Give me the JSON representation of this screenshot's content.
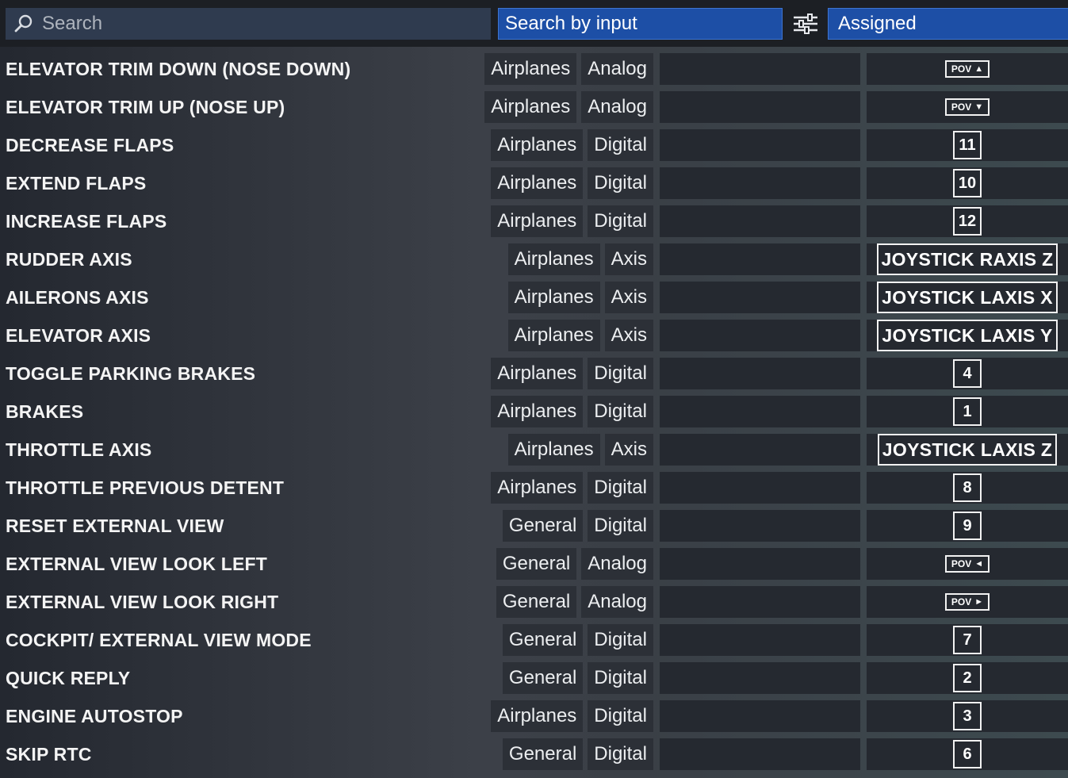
{
  "topbar": {
    "search_placeholder": "Search",
    "search_by_input_label": "Search by input",
    "assigned_label": "Assigned"
  },
  "rows": [
    {
      "action": "ELEVATOR TRIM DOWN (NOSE DOWN)",
      "category": "Airplanes",
      "type": "Analog",
      "binding": "POV",
      "binding_kind": "pov",
      "arrow": "▲"
    },
    {
      "action": "ELEVATOR TRIM UP (NOSE UP)",
      "category": "Airplanes",
      "type": "Analog",
      "binding": "POV",
      "binding_kind": "pov",
      "arrow": "▼"
    },
    {
      "action": "DECREASE FLAPS",
      "category": "Airplanes",
      "type": "Digital",
      "binding": "11",
      "binding_kind": "num"
    },
    {
      "action": "EXTEND FLAPS",
      "category": "Airplanes",
      "type": "Digital",
      "binding": "10",
      "binding_kind": "num"
    },
    {
      "action": "INCREASE FLAPS",
      "category": "Airplanes",
      "type": "Digital",
      "binding": "12",
      "binding_kind": "num"
    },
    {
      "action": "RUDDER AXIS",
      "category": "Airplanes",
      "type": "Axis",
      "binding": "JOYSTICK RAXIS Z",
      "binding_kind": "axis"
    },
    {
      "action": "AILERONS AXIS",
      "category": "Airplanes",
      "type": "Axis",
      "binding": "JOYSTICK LAXIS X",
      "binding_kind": "axis"
    },
    {
      "action": "ELEVATOR AXIS",
      "category": "Airplanes",
      "type": "Axis",
      "binding": "JOYSTICK LAXIS Y",
      "binding_kind": "axis"
    },
    {
      "action": "TOGGLE PARKING BRAKES",
      "category": "Airplanes",
      "type": "Digital",
      "binding": "4",
      "binding_kind": "num"
    },
    {
      "action": "BRAKES",
      "category": "Airplanes",
      "type": "Digital",
      "binding": "1",
      "binding_kind": "num"
    },
    {
      "action": "THROTTLE AXIS",
      "category": "Airplanes",
      "type": "Axis",
      "binding": "JOYSTICK LAXIS Z",
      "binding_kind": "axis"
    },
    {
      "action": "THROTTLE PREVIOUS DETENT",
      "category": "Airplanes",
      "type": "Digital",
      "binding": "8",
      "binding_kind": "num"
    },
    {
      "action": "RESET EXTERNAL VIEW",
      "category": "General",
      "type": "Digital",
      "binding": "9",
      "binding_kind": "num"
    },
    {
      "action": "EXTERNAL VIEW LOOK LEFT",
      "category": "General",
      "type": "Analog",
      "binding": "POV",
      "binding_kind": "pov",
      "arrow": "◄"
    },
    {
      "action": "EXTERNAL VIEW LOOK RIGHT",
      "category": "General",
      "type": "Analog",
      "binding": "POV",
      "binding_kind": "pov",
      "arrow": "►"
    },
    {
      "action": "COCKPIT/ EXTERNAL VIEW MODE",
      "category": "General",
      "type": "Digital",
      "binding": "7",
      "binding_kind": "num"
    },
    {
      "action": "QUICK REPLY",
      "category": "General",
      "type": "Digital",
      "binding": "2",
      "binding_kind": "num"
    },
    {
      "action": "ENGINE AUTOSTOP",
      "category": "Airplanes",
      "type": "Digital",
      "binding": "3",
      "binding_kind": "num"
    },
    {
      "action": "SKIP RTC",
      "category": "General",
      "type": "Digital",
      "binding": "6",
      "binding_kind": "num"
    }
  ]
}
